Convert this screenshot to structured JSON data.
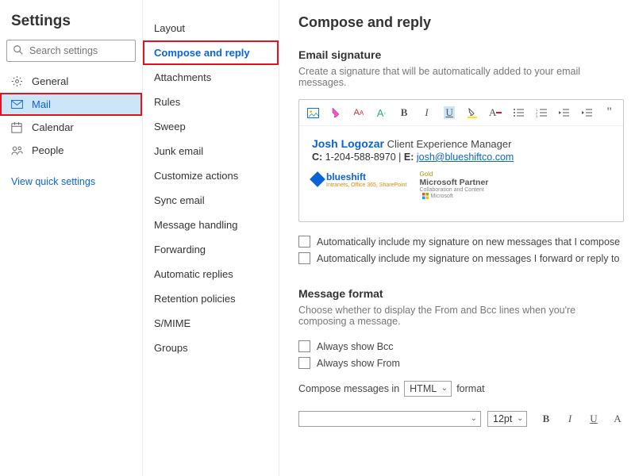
{
  "col1": {
    "title": "Settings",
    "search_placeholder": "Search settings",
    "items": [
      {
        "label": "General"
      },
      {
        "label": "Mail",
        "selected": true
      },
      {
        "label": "Calendar"
      },
      {
        "label": "People"
      }
    ],
    "quick": "View quick settings"
  },
  "col2": {
    "items": [
      "Layout",
      "Compose and reply",
      "Attachments",
      "Rules",
      "Sweep",
      "Junk email",
      "Customize actions",
      "Sync email",
      "Message handling",
      "Forwarding",
      "Automatic replies",
      "Retention policies",
      "S/MIME",
      "Groups"
    ],
    "active_index": 1
  },
  "main": {
    "heading": "Compose and reply",
    "sig_section_title": "Email signature",
    "sig_section_desc": "Create a signature that will be automatically added to your email messages.",
    "signature": {
      "name": "Josh Logozar",
      "title": "Client Experience Manager",
      "phone_label": "C:",
      "phone": "1-204-588-8970",
      "email_label": "E:",
      "email": "josh@blueshiftco.com",
      "logo1": "blueshift",
      "logo1_sub": "Intranets, Office 365, SharePoint",
      "logo2_gold": "Gold",
      "logo2_mp": "Microsoft Partner",
      "logo2_tag": "Collaboration and Content",
      "logo3": "Microsoft"
    },
    "check_new": "Automatically include my signature on new messages that I compose",
    "check_fwd": "Automatically include my signature on messages I forward or reply to",
    "mf_title": "Message format",
    "mf_desc": "Choose whether to display the From and Bcc lines when you're composing a message.",
    "chk_bcc": "Always show Bcc",
    "chk_from": "Always show From",
    "compose_pre": "Compose messages in",
    "compose_sel": "HTML",
    "compose_post": "format",
    "font_size_sel": "12pt"
  }
}
